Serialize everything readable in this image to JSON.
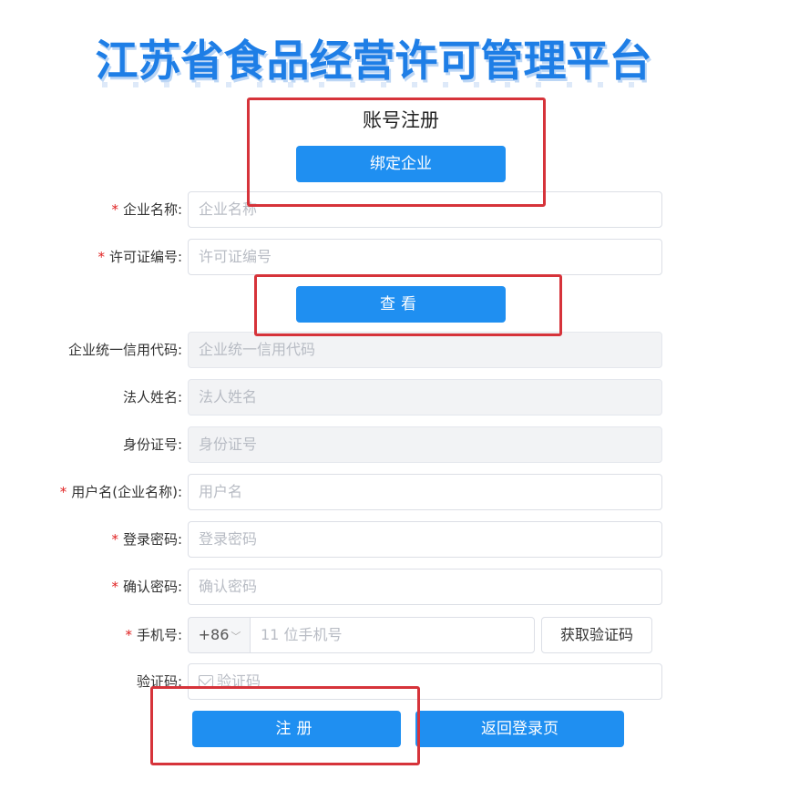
{
  "banner": {
    "title": "江苏省食品经营许可管理平台"
  },
  "form": {
    "title": "账号注册",
    "bind_button": "绑定企业",
    "view_button": "查看",
    "fields": [
      {
        "label": "企业名称:",
        "required": true,
        "placeholder": "企业名称",
        "disabled": false
      },
      {
        "label": "许可证编号:",
        "required": true,
        "placeholder": "许可证编号",
        "disabled": false
      },
      {
        "label": "企业统一信用代码:",
        "required": false,
        "placeholder": "企业统一信用代码",
        "disabled": true
      },
      {
        "label": "法人姓名:",
        "required": false,
        "placeholder": "法人姓名",
        "disabled": true
      },
      {
        "label": "身份证号:",
        "required": false,
        "placeholder": "身份证号",
        "disabled": true
      },
      {
        "label": "用户名(企业名称):",
        "required": true,
        "placeholder": "用户名",
        "disabled": false
      },
      {
        "label": "登录密码:",
        "required": true,
        "placeholder": "登录密码",
        "disabled": false
      },
      {
        "label": "确认密码:",
        "required": true,
        "placeholder": "确认密码",
        "disabled": false
      }
    ],
    "phone": {
      "label": "手机号:",
      "required": true,
      "prefix": "+86",
      "placeholder": "11 位手机号",
      "code_button": "获取验证码"
    },
    "verify": {
      "label": "验证码:",
      "placeholder": "验证码"
    },
    "register_button": "注册",
    "back_button": "返回登录页"
  },
  "colors": {
    "primary": "#1f8ff1",
    "highlight": "#d6333a",
    "required": "#e02020"
  }
}
